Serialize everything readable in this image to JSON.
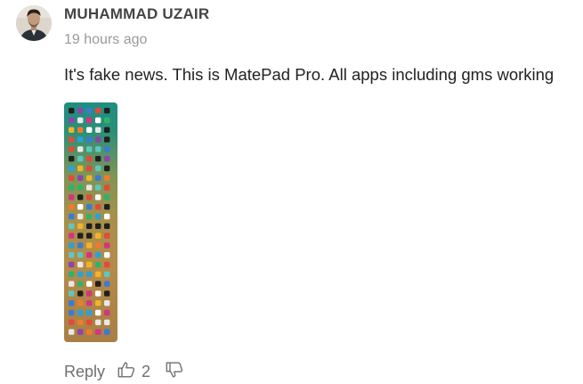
{
  "comment": {
    "author": "MUHAMMAD UZAIR",
    "timestamp": "19 hours ago",
    "text": "It's fake news. This is MatePad Pro. All apps including gms working",
    "actions": {
      "reply_label": "Reply",
      "like_count": "2"
    }
  },
  "icons": {
    "avatar": "user-avatar",
    "like": "thumbs-up-icon",
    "dislike": "thumbs-down-icon"
  },
  "colors": {
    "author": "#444444",
    "timestamp": "#9a9a9a",
    "action": "#6f6f6f"
  }
}
